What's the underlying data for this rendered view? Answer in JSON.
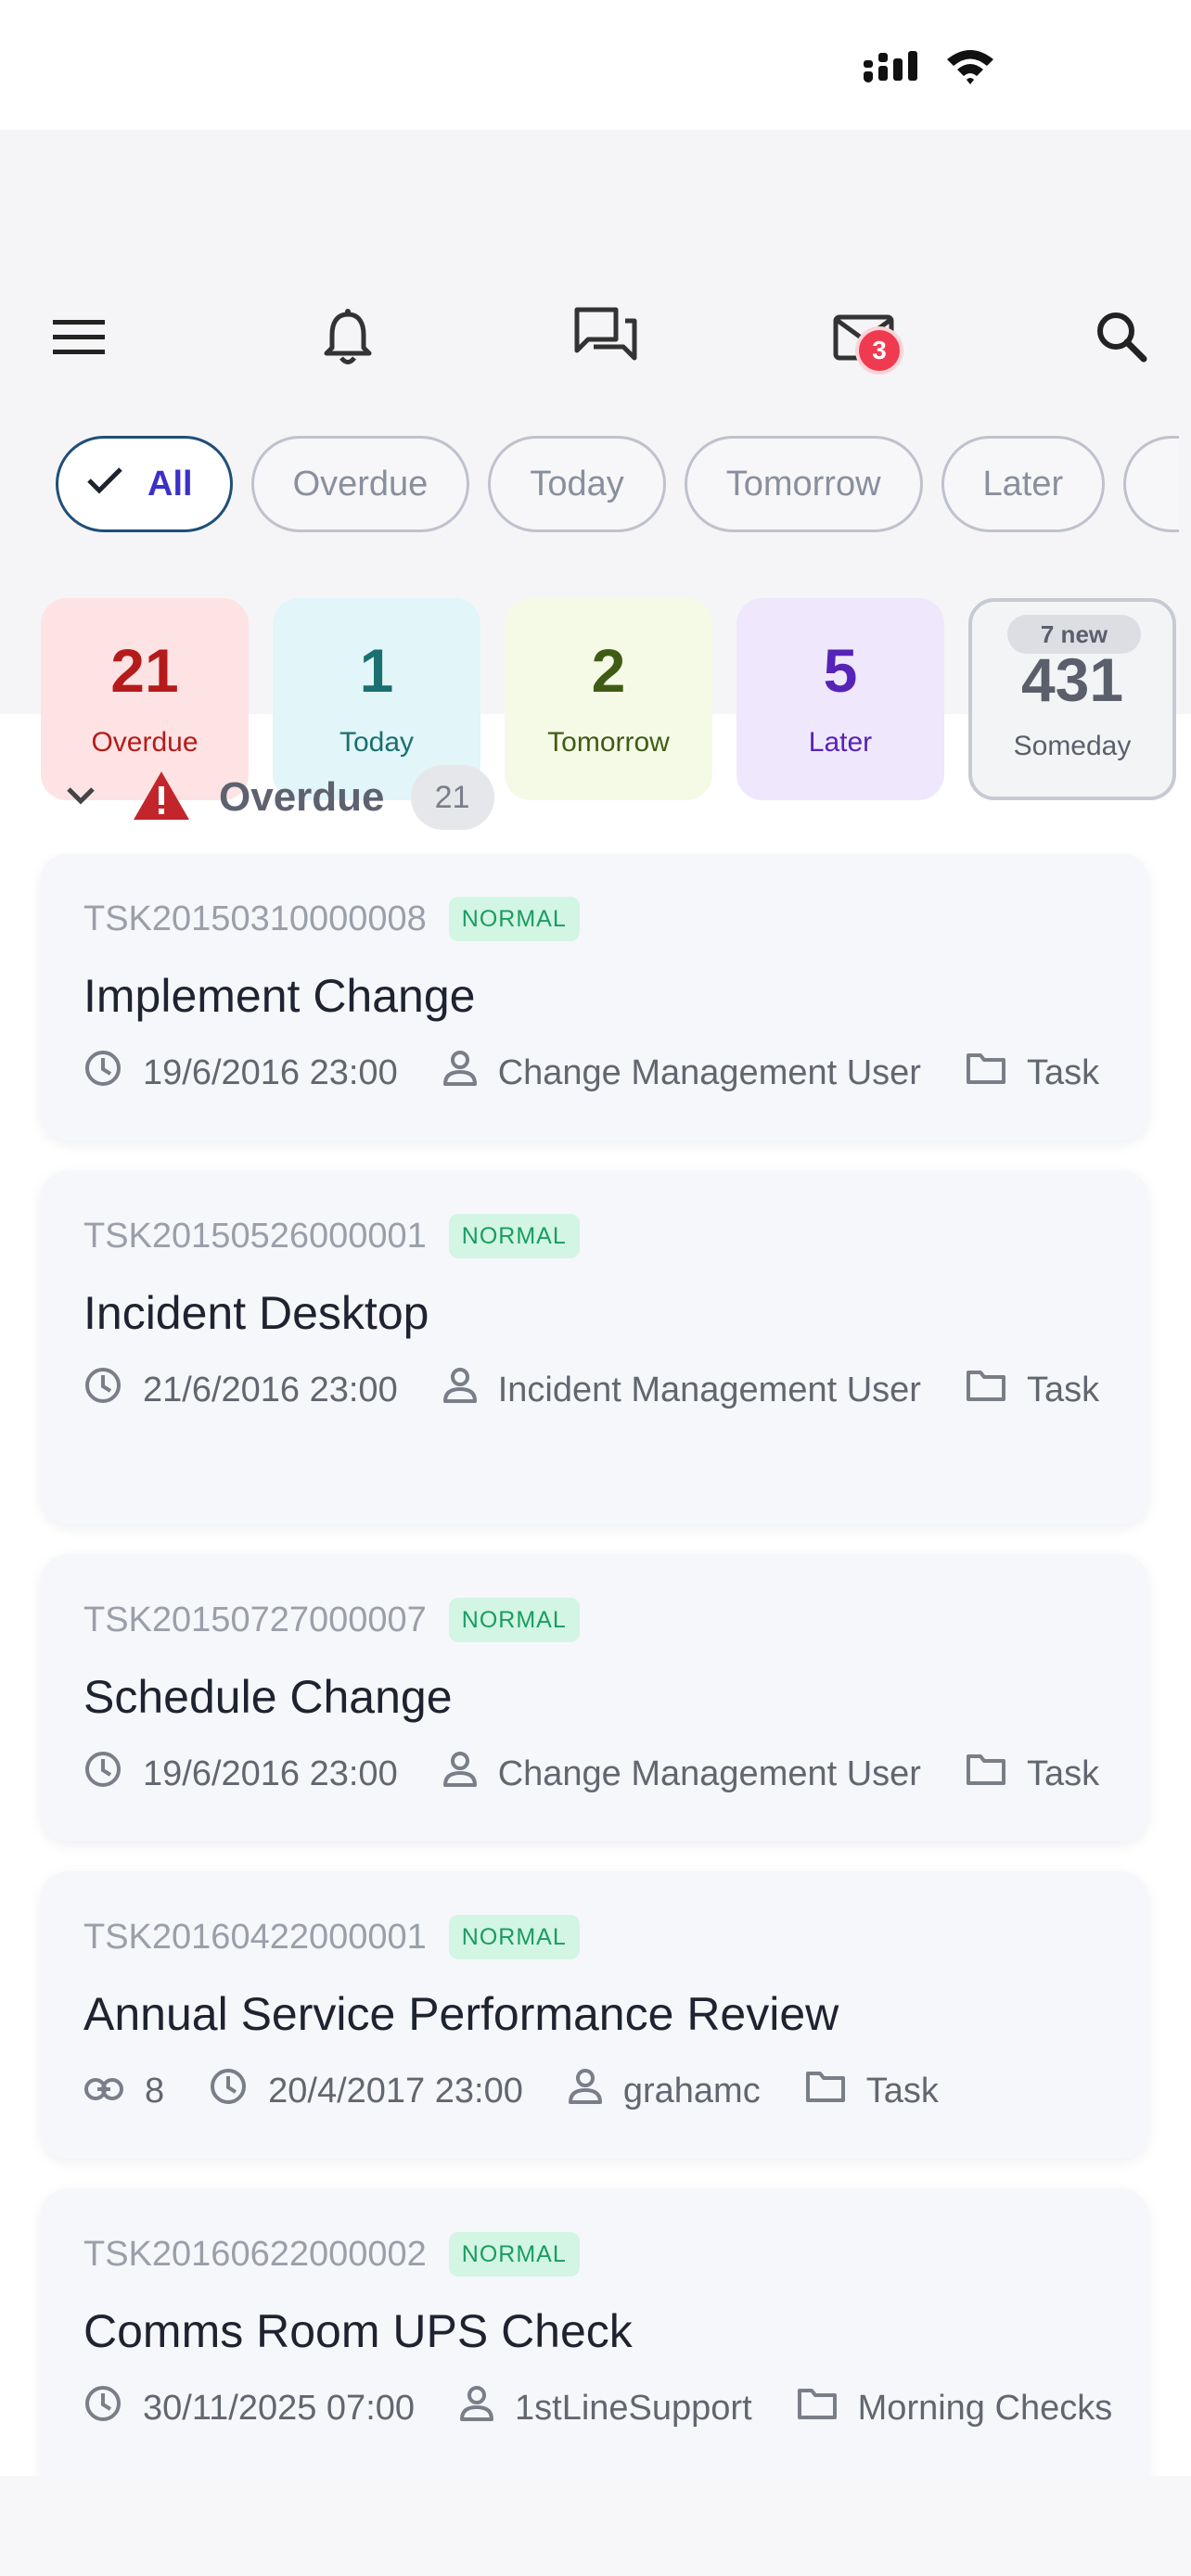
{
  "header": {
    "notifications_badge": "3"
  },
  "filters": [
    {
      "label": "All",
      "active": true
    },
    {
      "label": "Overdue"
    },
    {
      "label": "Today"
    },
    {
      "label": "Tomorrow"
    },
    {
      "label": "Later"
    }
  ],
  "summary": {
    "overdue": {
      "count": "21",
      "label": "Overdue"
    },
    "today": {
      "count": "1",
      "label": "Today"
    },
    "tomorrow": {
      "count": "2",
      "label": "Tomorrow"
    },
    "later": {
      "count": "5",
      "label": "Later"
    },
    "someday": {
      "count": "431",
      "label": "Someday",
      "new": "7 new"
    }
  },
  "section": {
    "title": "Overdue",
    "count": "21"
  },
  "tasks": [
    {
      "id": "TSK20150310000008",
      "priority": "NORMAL",
      "title": "Implement Change",
      "due": "19/6/2016 23:00",
      "assignee": "Change Management User",
      "category": "Task"
    },
    {
      "id": "TSK20150526000001",
      "priority": "NORMAL",
      "title": "Incident Desktop",
      "due": "21/6/2016 23:00",
      "assignee": "Incident Management User",
      "category": "Task"
    },
    {
      "id": "TSK20150727000007",
      "priority": "NORMAL",
      "title": "Schedule Change",
      "due": "19/6/2016 23:00",
      "assignee": "Change Management User",
      "category": "Task"
    },
    {
      "id": "TSK20160422000001",
      "priority": "NORMAL",
      "title": "Annual Service Performance Review",
      "links": "8",
      "due": "20/4/2017 23:00",
      "assignee": "grahamc",
      "category": "Task"
    },
    {
      "id": "TSK20160622000002",
      "priority": "NORMAL",
      "title": "Comms Room UPS Check",
      "due": "30/11/2025 07:00",
      "assignee": "1stLineSupport",
      "category": "Morning Checks"
    }
  ],
  "colors": {
    "accent": "#3a31c9",
    "overdue": "#b61b1b",
    "badge": "#f03a4f",
    "priority_bg": "#d3f5e4",
    "priority_text": "#1a9d5f"
  }
}
